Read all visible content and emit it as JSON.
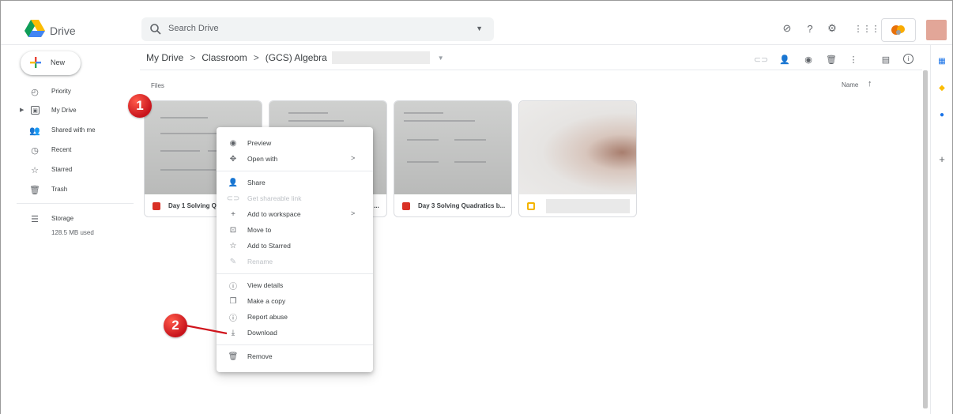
{
  "app": {
    "title": "Drive"
  },
  "search": {
    "placeholder": "Search Drive"
  },
  "header": {
    "icons": [
      "offline-status-icon",
      "help-icon",
      "settings-icon",
      "apps-grid-icon"
    ],
    "colors": {
      "accent": "#1a73e8",
      "account_swatch": "#e2a698"
    }
  },
  "sidebar": {
    "new_label": "New",
    "items": [
      {
        "label": "Priority",
        "icon": "priority-icon"
      },
      {
        "label": "My Drive",
        "icon": "my-drive-icon"
      },
      {
        "label": "Shared with me",
        "icon": "shared-icon"
      },
      {
        "label": "Recent",
        "icon": "clock-icon"
      },
      {
        "label": "Starred",
        "icon": "star-icon"
      },
      {
        "label": "Trash",
        "icon": "trash-icon"
      }
    ],
    "storage": {
      "label": "Storage",
      "used": "128.5 MB used"
    }
  },
  "breadcrumb": {
    "items": [
      "My Drive",
      "Classroom",
      "(GCS) Algebra"
    ],
    "separator": ">"
  },
  "main": {
    "section_label": "Files",
    "sort_label": "Name",
    "files": [
      {
        "name": "Day 1 Solving Q",
        "type": "image",
        "color": "#d93025"
      },
      {
        "name": "...",
        "type": "image",
        "color": "#d93025"
      },
      {
        "name": "Day 3 Solving Quadratics b...",
        "type": "image",
        "color": "#d93025"
      },
      {
        "name": "",
        "type": "slides",
        "color": "#f4b400"
      }
    ]
  },
  "context_menu": {
    "items": [
      {
        "label": "Preview",
        "icon": "eye-icon"
      },
      {
        "label": "Open with",
        "icon": "open-with-icon",
        "submenu": ">"
      },
      {
        "label": "Share",
        "icon": "share-person-icon"
      },
      {
        "label": "Get shareable link",
        "icon": "link-icon",
        "disabled": true
      },
      {
        "label": "Add to workspace",
        "icon": "plus-icon",
        "submenu": ">"
      },
      {
        "label": "Move to",
        "icon": "move-to-icon"
      },
      {
        "label": "Add to Starred",
        "icon": "star-icon"
      },
      {
        "label": "Rename",
        "icon": "pencil-icon",
        "disabled": true
      },
      {
        "label": "View details",
        "icon": "info-icon"
      },
      {
        "label": "Make a copy",
        "icon": "copy-icon"
      },
      {
        "label": "Report abuse",
        "icon": "report-icon"
      },
      {
        "label": "Download",
        "icon": "download-icon"
      },
      {
        "label": "Remove",
        "icon": "trash-icon"
      }
    ]
  },
  "annotations": {
    "step1": "1",
    "step2": "2",
    "color": "#d0141c"
  }
}
